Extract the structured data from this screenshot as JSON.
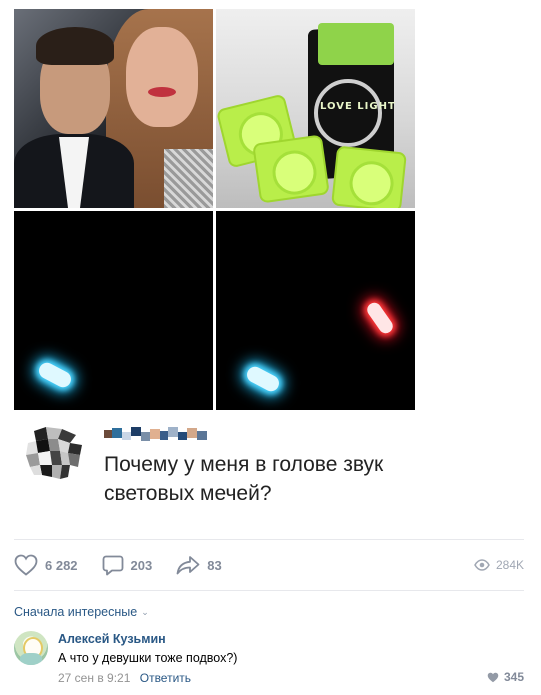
{
  "post": {
    "reply_card": {
      "text": "Почему у меня в голове звук световых мечей?"
    },
    "photo_text": "LOVE LIGHT",
    "actions": {
      "likes": "6 282",
      "comments": "203",
      "shares": "83",
      "views": "284K"
    }
  },
  "comments_section": {
    "sort_label": "Сначала интересные",
    "comment": {
      "author": "Алексей Кузьмин",
      "text": "А что у девушки тоже подвох?)",
      "date": "27 сен в 9:21",
      "reply_label": "Ответить",
      "likes": "345"
    }
  },
  "colors": {
    "link": "#2a5885",
    "muted": "#828a99",
    "divider": "#e7e8ec"
  },
  "icons": [
    "heart-icon",
    "comment-icon",
    "share-icon",
    "eye-icon",
    "chevron-down-icon",
    "small-heart-icon"
  ]
}
